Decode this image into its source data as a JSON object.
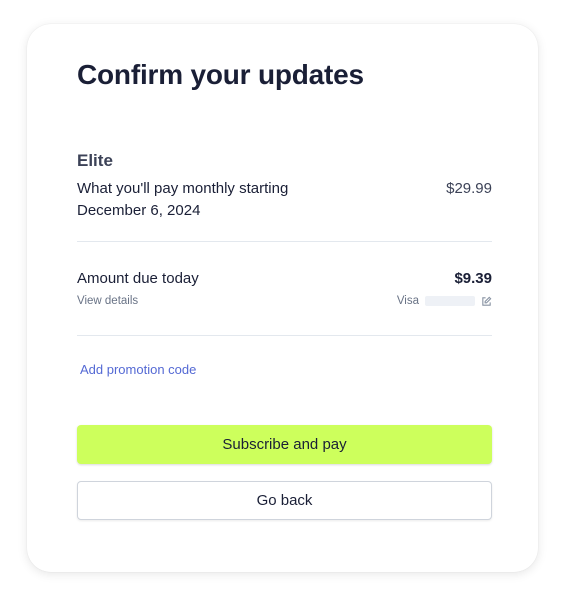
{
  "header": {
    "title": "Confirm your updates"
  },
  "plan": {
    "name": "Elite",
    "description_line1": "What you'll pay monthly starting",
    "description_line2": "December 6, 2024",
    "price": "$29.99"
  },
  "due": {
    "label": "Amount due today",
    "amount": "$9.39",
    "details_link": "View details",
    "card_brand": "Visa"
  },
  "promo": {
    "label": "Add promotion code"
  },
  "actions": {
    "primary_label": "Subscribe and pay",
    "secondary_label": "Go back"
  },
  "colors": {
    "primary_button": "#cdff5c",
    "link": "#5469d4"
  }
}
